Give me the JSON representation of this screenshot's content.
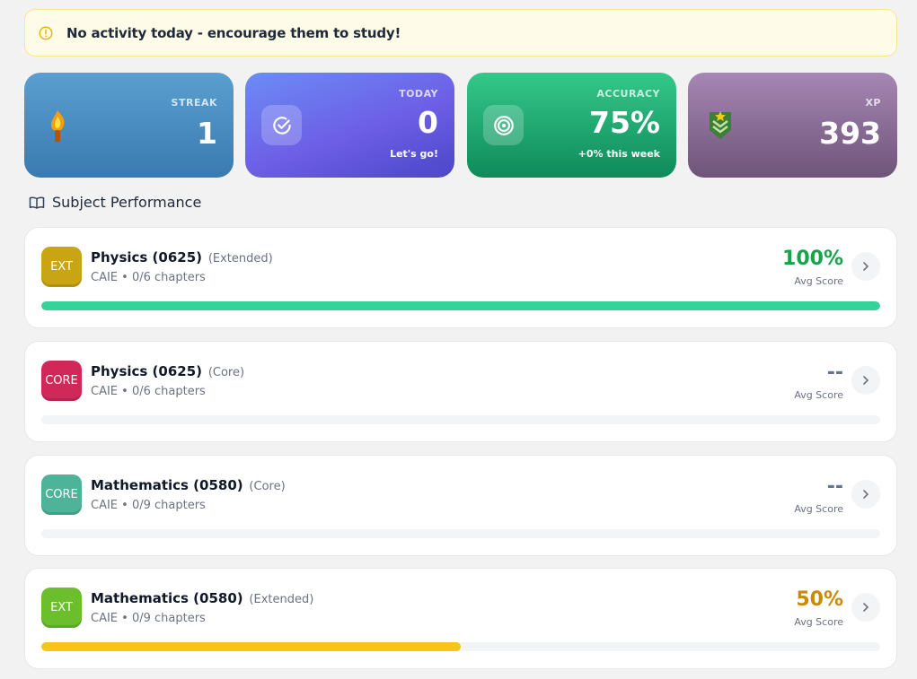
{
  "alert": {
    "text": "No activity today - encourage them to study!",
    "icon": "warning-circle-icon",
    "accent": "#eab308"
  },
  "stats": {
    "streak": {
      "label": "STREAK",
      "value": "1",
      "icon": "torch-icon"
    },
    "today": {
      "label": "TODAY",
      "value": "0",
      "sub": "Let's go!",
      "icon": "check-circle-icon"
    },
    "accuracy": {
      "label": "ACCURACY",
      "value": "75%",
      "sub": "+0% this week",
      "icon": "target-icon"
    },
    "xp": {
      "label": "XP",
      "value": "393",
      "icon": "chevron-rank-icon"
    }
  },
  "section": {
    "title": "Subject Performance",
    "icon": "open-book-icon"
  },
  "subjects": [
    {
      "badge": "EXT",
      "name": "Physics (0625)",
      "level": "(Extended)",
      "meta": "CAIE • 0/6 chapters",
      "score": "100%",
      "score_label": "Avg Score",
      "progress": 1.0,
      "badge_color": "#c9a514",
      "score_color": "#16a34a",
      "bar_color": "#34d399"
    },
    {
      "badge": "CORE",
      "name": "Physics (0625)",
      "level": "(Core)",
      "meta": "CAIE • 0/6 chapters",
      "score": "--",
      "score_label": "Avg Score",
      "progress": 0,
      "badge_color": "#d1285a",
      "score_color": "#64748b",
      "bar_color": "#e5e7eb"
    },
    {
      "badge": "CORE",
      "name": "Mathematics (0580)",
      "level": "(Core)",
      "meta": "CAIE • 0/9 chapters",
      "score": "--",
      "score_label": "Avg Score",
      "progress": 0,
      "badge_color": "#4fb39a",
      "score_color": "#64748b",
      "bar_color": "#e5e7eb"
    },
    {
      "badge": "EXT",
      "name": "Mathematics (0580)",
      "level": "(Extended)",
      "meta": "CAIE • 0/9 chapters",
      "score": "50%",
      "score_label": "Avg Score",
      "progress": 0.5,
      "badge_color": "#6cbf2c",
      "score_color": "#ca8a04",
      "bar_color": "#f5c518"
    }
  ]
}
